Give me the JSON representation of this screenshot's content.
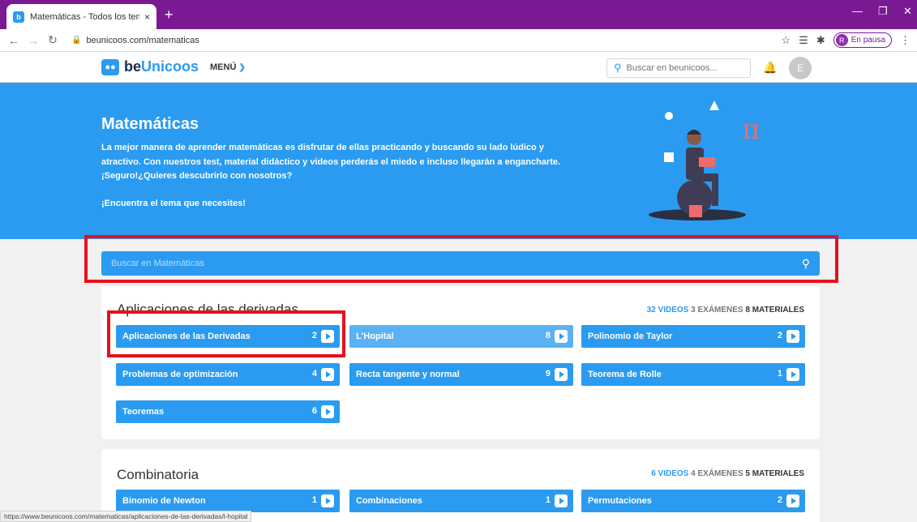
{
  "browser": {
    "tab_title": "Matemáticas - Todos los temas",
    "tab_close": "×",
    "new_tab": "+",
    "url": "beunicoos.com/matematicas",
    "profile_initial": "R",
    "profile_status": "En pausa",
    "status_url": "https://www.beunicoos.com/matematicas/aplicaciones-de-las-derivadas/l-hopital"
  },
  "header": {
    "logo_prefix": "be",
    "logo_highlight": "Unicoos",
    "menu_label": "MENÚ",
    "search_placeholder": "Buscar en beunicoos...",
    "avatar_initial": "E"
  },
  "hero": {
    "title": "Matemáticas",
    "description": "La mejor manera de aprender matemáticas es disfrutar de ellas practicando y buscando su lado lúdico y atractivo. Con nuestros test, material didáctico y videos perderás el miedo e incluso llegarán a engancharte. ¡Seguro!¿Quieres descubrirlo con nosotros?",
    "cta": "¡Encuentra el tema que necesites!",
    "pi_symbol": "π"
  },
  "main_search": {
    "placeholder": "Buscar en Matemáticas"
  },
  "sections": [
    {
      "title": "Aplicaciones de las derivadas",
      "videos": "32 VIDEOS",
      "exams": "3 EXÁMENES",
      "materials": "8 MATERIALES",
      "topics": [
        {
          "label": "Aplicaciones de las Derivadas",
          "count": "2"
        },
        {
          "label": "L'Hopital",
          "count": "8"
        },
        {
          "label": "Polinomio de Taylor",
          "count": "2"
        },
        {
          "label": "Problemas de optimización",
          "count": "4"
        },
        {
          "label": "Recta tangente y normal",
          "count": "9"
        },
        {
          "label": "Teorema de Rolle",
          "count": "1"
        },
        {
          "label": "Teoremas",
          "count": "6"
        }
      ]
    },
    {
      "title": "Combinatoria",
      "videos": "6 VIDEOS",
      "exams": "4 EXÁMENES",
      "materials": "5 MATERIALES",
      "topics": [
        {
          "label": "Binomio de Newton",
          "count": "1"
        },
        {
          "label": "Combinaciones",
          "count": "1"
        },
        {
          "label": "Permutaciones",
          "count": "2"
        }
      ]
    }
  ],
  "colors": {
    "brand": "#2a9bf0",
    "browser_frame": "#7a1a93",
    "highlight": "#e8101c"
  }
}
